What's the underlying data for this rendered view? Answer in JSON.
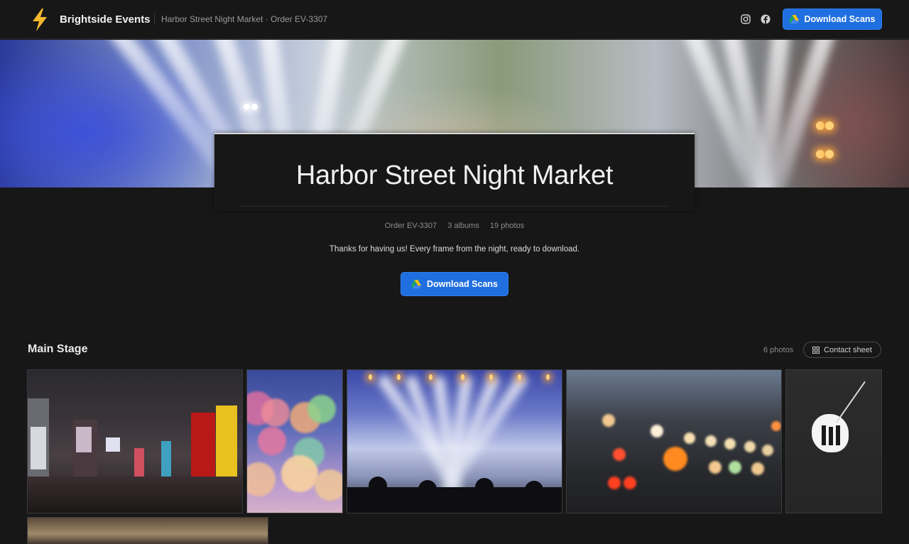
{
  "header": {
    "brand": "Brightside Events",
    "breadcrumb": "Harbor Street Night Market · Order EV-3307",
    "download_label": "Download Scans",
    "social_icons": [
      "instagram-icon",
      "facebook-icon"
    ]
  },
  "event": {
    "title": "Harbor Street Night Market",
    "order": "Order EV-3307",
    "albums": "3 albums",
    "photos": "19 photos",
    "message": "Thanks for having us! Every frame from the night, ready to download.",
    "download_label": "Download Scans"
  },
  "album": {
    "title": "Main Stage",
    "count": "6 photos",
    "contact_sheet_label": "Contact sheet"
  },
  "colors": {
    "background": "#171717",
    "accent": "#1f6fe0",
    "logo": "#f5b82e"
  }
}
